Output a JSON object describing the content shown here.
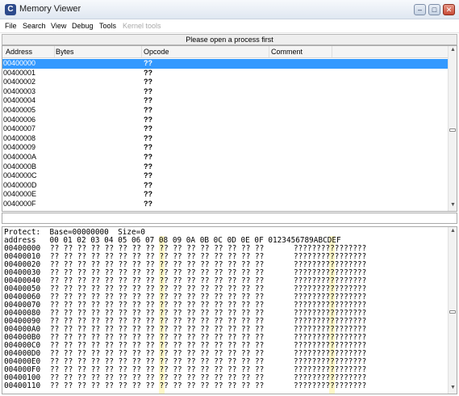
{
  "window": {
    "app_icon": "cheat-engine-icon",
    "title": "Memory Viewer",
    "buttons": [
      "minimize-icon",
      "maximize-icon",
      "close-icon"
    ]
  },
  "menu": {
    "items": [
      "File",
      "Search",
      "View",
      "Debug",
      "Tools",
      "Kernel tools"
    ]
  },
  "banner": "Please open a process first",
  "disassembler": {
    "columns": [
      "Address",
      "Bytes",
      "Opcode",
      "Comment"
    ],
    "selected_row": 0,
    "rows": [
      {
        "address": "00400000",
        "opcode": "??"
      },
      {
        "address": "00400001",
        "opcode": "??"
      },
      {
        "address": "00400002",
        "opcode": "??"
      },
      {
        "address": "00400003",
        "opcode": "??"
      },
      {
        "address": "00400004",
        "opcode": "??"
      },
      {
        "address": "00400005",
        "opcode": "??"
      },
      {
        "address": "00400006",
        "opcode": "??"
      },
      {
        "address": "00400007",
        "opcode": "??"
      },
      {
        "address": "00400008",
        "opcode": "??"
      },
      {
        "address": "00400009",
        "opcode": "??"
      },
      {
        "address": "0040000A",
        "opcode": "??"
      },
      {
        "address": "0040000B",
        "opcode": "??"
      },
      {
        "address": "0040000C",
        "opcode": "??"
      },
      {
        "address": "0040000D",
        "opcode": "??"
      },
      {
        "address": "0040000E",
        "opcode": "??"
      },
      {
        "address": "0040000F",
        "opcode": "??"
      }
    ]
  },
  "address_input": {
    "value": ""
  },
  "hex_view": {
    "info": "Protect:  Base=00000000  Size=0",
    "header": "address   00 01 02 03 04 05 06 07 08 09 0A 0B 0C 0D 0E 0F 0123456789ABCDEF",
    "rows": [
      {
        "address": "00400000",
        "bytes": "?? ?? ?? ?? ?? ?? ?? ?? ?? ?? ?? ?? ?? ?? ?? ??",
        "ascii": "????????????????"
      },
      {
        "address": "00400010",
        "bytes": "?? ?? ?? ?? ?? ?? ?? ?? ?? ?? ?? ?? ?? ?? ?? ??",
        "ascii": "????????????????"
      },
      {
        "address": "00400020",
        "bytes": "?? ?? ?? ?? ?? ?? ?? ?? ?? ?? ?? ?? ?? ?? ?? ??",
        "ascii": "????????????????"
      },
      {
        "address": "00400030",
        "bytes": "?? ?? ?? ?? ?? ?? ?? ?? ?? ?? ?? ?? ?? ?? ?? ??",
        "ascii": "????????????????"
      },
      {
        "address": "00400040",
        "bytes": "?? ?? ?? ?? ?? ?? ?? ?? ?? ?? ?? ?? ?? ?? ?? ??",
        "ascii": "????????????????"
      },
      {
        "address": "00400050",
        "bytes": "?? ?? ?? ?? ?? ?? ?? ?? ?? ?? ?? ?? ?? ?? ?? ??",
        "ascii": "????????????????"
      },
      {
        "address": "00400060",
        "bytes": "?? ?? ?? ?? ?? ?? ?? ?? ?? ?? ?? ?? ?? ?? ?? ??",
        "ascii": "????????????????"
      },
      {
        "address": "00400070",
        "bytes": "?? ?? ?? ?? ?? ?? ?? ?? ?? ?? ?? ?? ?? ?? ?? ??",
        "ascii": "????????????????"
      },
      {
        "address": "00400080",
        "bytes": "?? ?? ?? ?? ?? ?? ?? ?? ?? ?? ?? ?? ?? ?? ?? ??",
        "ascii": "????????????????"
      },
      {
        "address": "00400090",
        "bytes": "?? ?? ?? ?? ?? ?? ?? ?? ?? ?? ?? ?? ?? ?? ?? ??",
        "ascii": "????????????????"
      },
      {
        "address": "004000A0",
        "bytes": "?? ?? ?? ?? ?? ?? ?? ?? ?? ?? ?? ?? ?? ?? ?? ??",
        "ascii": "????????????????"
      },
      {
        "address": "004000B0",
        "bytes": "?? ?? ?? ?? ?? ?? ?? ?? ?? ?? ?? ?? ?? ?? ?? ??",
        "ascii": "????????????????"
      },
      {
        "address": "004000C0",
        "bytes": "?? ?? ?? ?? ?? ?? ?? ?? ?? ?? ?? ?? ?? ?? ?? ??",
        "ascii": "????????????????"
      },
      {
        "address": "004000D0",
        "bytes": "?? ?? ?? ?? ?? ?? ?? ?? ?? ?? ?? ?? ?? ?? ?? ??",
        "ascii": "????????????????"
      },
      {
        "address": "004000E0",
        "bytes": "?? ?? ?? ?? ?? ?? ?? ?? ?? ?? ?? ?? ?? ?? ?? ??",
        "ascii": "????????????????"
      },
      {
        "address": "004000F0",
        "bytes": "?? ?? ?? ?? ?? ?? ?? ?? ?? ?? ?? ?? ?? ?? ?? ??",
        "ascii": "????????????????"
      },
      {
        "address": "00400100",
        "bytes": "?? ?? ?? ?? ?? ?? ?? ?? ?? ?? ?? ?? ?? ?? ?? ??",
        "ascii": "????????????????"
      },
      {
        "address": "00400110",
        "bytes": "?? ?? ?? ?? ?? ?? ?? ?? ?? ?? ?? ?? ?? ?? ?? ??",
        "ascii": "????????????????"
      }
    ]
  },
  "colors": {
    "selection": "#3399ff",
    "hex_column_highlight": "#fff8c8",
    "close_button": "#c84a36"
  }
}
